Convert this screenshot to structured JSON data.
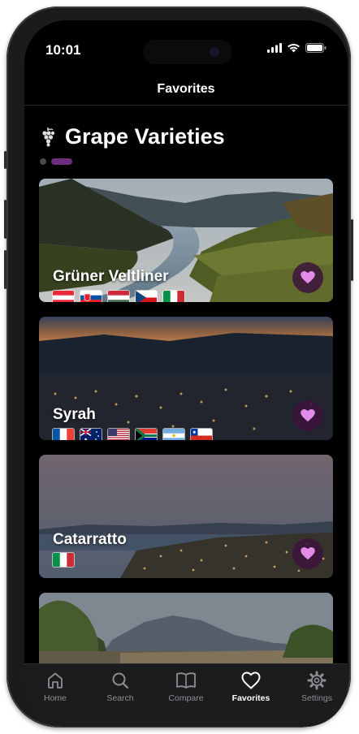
{
  "status_bar": {
    "time": "10:01"
  },
  "nav": {
    "title": "Favorites"
  },
  "section": {
    "title": "Grape Varieties",
    "icon": "grapes-icon",
    "page": 2,
    "page_count": 2
  },
  "colors": {
    "accent": "#6b2e7f",
    "heart": "#e38be8",
    "background": "#000000"
  },
  "cards": [
    {
      "title": "Grüner Veltliner",
      "flags": [
        "austria",
        "slovakia",
        "hungary",
        "czech-republic",
        "italy"
      ],
      "favorited": true
    },
    {
      "title": "Syrah",
      "flags": [
        "france",
        "australia",
        "usa",
        "south-africa",
        "argentina",
        "chile"
      ],
      "favorited": true
    },
    {
      "title": "Catarratto",
      "flags": [
        "italy"
      ],
      "favorited": true
    },
    {
      "title": "",
      "flags": [],
      "favorited": true
    }
  ],
  "tabs": [
    {
      "label": "Home",
      "icon": "house-icon",
      "active": false
    },
    {
      "label": "Search",
      "icon": "magnifier-icon",
      "active": false
    },
    {
      "label": "Compare",
      "icon": "book-icon",
      "active": false
    },
    {
      "label": "Favorites",
      "icon": "heart-icon",
      "active": true
    },
    {
      "label": "Settings",
      "icon": "gear-icon",
      "active": false
    }
  ]
}
